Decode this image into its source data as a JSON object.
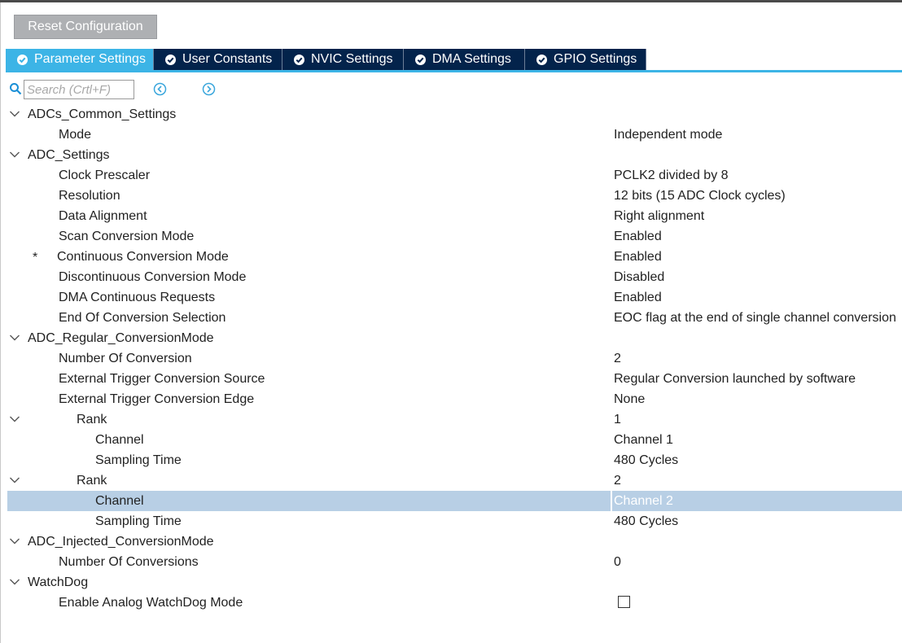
{
  "toolbar": {
    "reset_label": "Reset Configuration"
  },
  "tabs": [
    {
      "label": "Parameter Settings",
      "active": true
    },
    {
      "label": "User Constants",
      "active": false
    },
    {
      "label": "NVIC Settings",
      "active": false
    },
    {
      "label": "DMA Settings",
      "active": false
    },
    {
      "label": "GPIO Settings",
      "active": false
    }
  ],
  "search": {
    "placeholder": "Search (Crtl+F)"
  },
  "colors": {
    "tab_active": "#3cb4e6",
    "tab_inactive": "#03234b",
    "selection": "#b8cfe5"
  },
  "tree": [
    {
      "label": "ADCs_Common_Settings",
      "level": 0,
      "expandable": true
    },
    {
      "label": "Mode",
      "value": "Independent mode",
      "level": 1
    },
    {
      "label": "ADC_Settings",
      "level": 0,
      "expandable": true
    },
    {
      "label": "Clock Prescaler",
      "value": "PCLK2 divided by 8",
      "level": 1
    },
    {
      "label": "Resolution",
      "value": "12 bits (15 ADC Clock cycles)",
      "level": 1
    },
    {
      "label": "Data Alignment",
      "value": "Right alignment",
      "level": 1
    },
    {
      "label": "Scan Conversion Mode",
      "value": "Enabled",
      "level": 1
    },
    {
      "label": "Continuous Conversion Mode",
      "value": "Enabled",
      "level": 1,
      "modified": true,
      "marker": "*"
    },
    {
      "label": "Discontinuous Conversion Mode",
      "value": "Disabled",
      "level": 1
    },
    {
      "label": "DMA Continuous Requests",
      "value": "Enabled",
      "level": 1
    },
    {
      "label": "End Of Conversion Selection",
      "value": "EOC flag at the end of single channel conversion",
      "level": 1
    },
    {
      "label": "ADC_Regular_ConversionMode",
      "level": 0,
      "expandable": true
    },
    {
      "label": "Number Of Conversion",
      "value": "2",
      "level": 1
    },
    {
      "label": "External Trigger Conversion Source",
      "value": "Regular Conversion launched by software",
      "level": 1
    },
    {
      "label": "External Trigger Conversion Edge",
      "value": "None",
      "level": 1
    },
    {
      "label": "Rank",
      "value": "1",
      "level": 2,
      "expandable": true
    },
    {
      "label": "Channel",
      "value": "Channel 1",
      "level": 3
    },
    {
      "label": "Sampling Time",
      "value": "480 Cycles",
      "level": 3
    },
    {
      "label": "Rank",
      "value": "2",
      "level": 2,
      "expandable": true
    },
    {
      "label": "Channel",
      "value": "Channel 2",
      "level": 3,
      "selected": true
    },
    {
      "label": "Sampling Time",
      "value": "480 Cycles",
      "level": 3
    },
    {
      "label": "ADC_Injected_ConversionMode",
      "level": 0,
      "expandable": true
    },
    {
      "label": "Number Of Conversions",
      "value": "0",
      "level": 1
    },
    {
      "label": "WatchDog",
      "level": 0,
      "expandable": true
    },
    {
      "label": "Enable Analog WatchDog Mode",
      "level": 1,
      "checkbox": true,
      "checked": false
    }
  ]
}
